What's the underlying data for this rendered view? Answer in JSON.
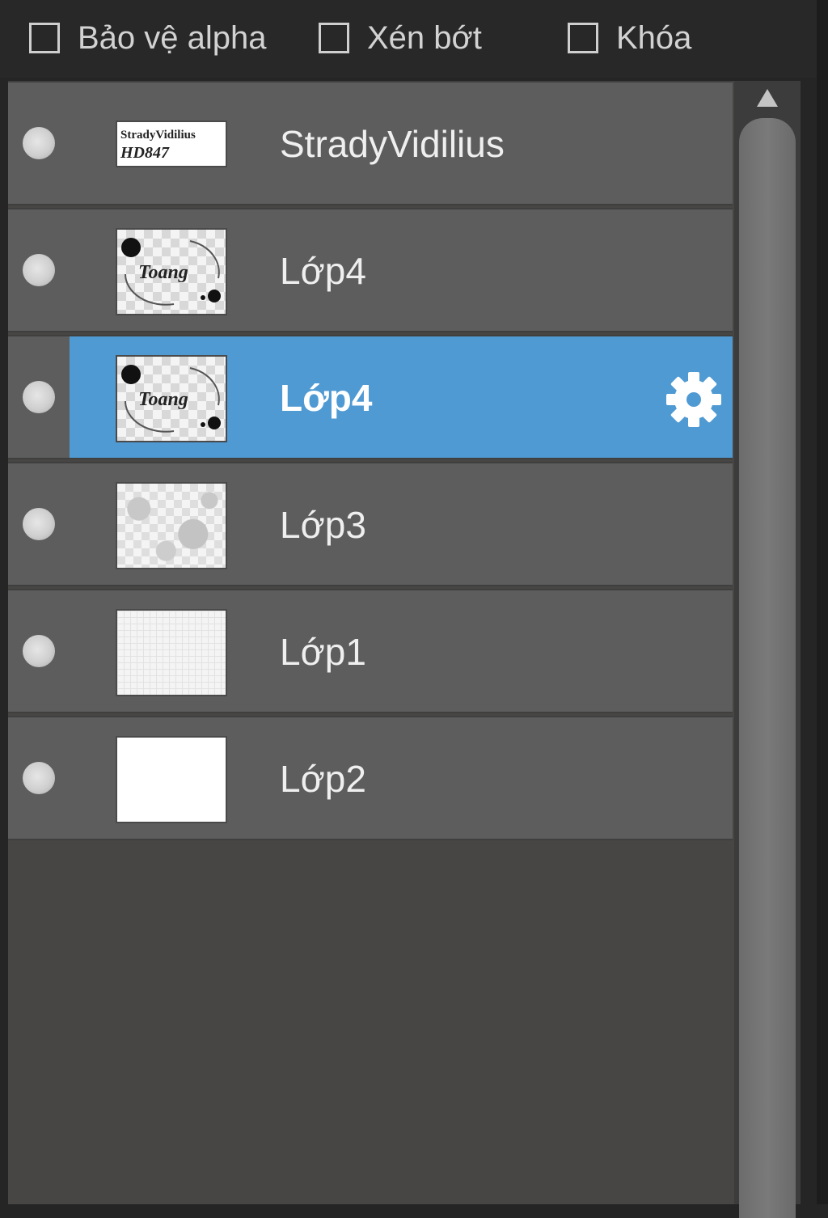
{
  "options": {
    "protect_alpha": {
      "label": "Bảo vệ alpha",
      "checked": false
    },
    "clip": {
      "label": "Xén bớt",
      "checked": false
    },
    "lock": {
      "label": "Khóa",
      "checked": false
    }
  },
  "layers": [
    {
      "name": "StradyVidilius",
      "thumbnail": "text-thumbnail",
      "selected": false
    },
    {
      "name": "Lớp4",
      "thumbnail": "logo-thumbnail",
      "selected": false
    },
    {
      "name": "Lớp4",
      "thumbnail": "logo-thumbnail",
      "selected": true
    },
    {
      "name": "Lớp3",
      "thumbnail": "blotchy-transparent-thumbnail",
      "selected": false
    },
    {
      "name": "Lớp1",
      "thumbnail": "grid-thumbnail",
      "selected": false
    },
    {
      "name": "Lớp2",
      "thumbnail": "white-thumbnail",
      "selected": false
    }
  ],
  "thumbnail_text": {
    "text_layer_line1": "StradyVidilius",
    "text_layer_line2": "HD847",
    "logo_word": "Toang"
  },
  "icons": {
    "visibility": "visibility-dot-icon",
    "settings": "gear-icon",
    "scroll_up": "triangle-up-icon"
  },
  "colors": {
    "selected_row": "#4f9ad3",
    "row": "#5d5d5d",
    "list_bg": "#474644",
    "panel_bg": "#252525"
  }
}
